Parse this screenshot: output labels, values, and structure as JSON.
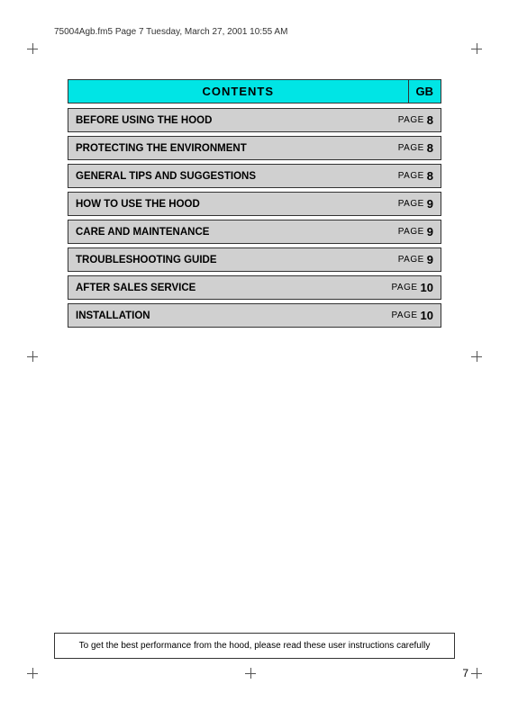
{
  "header": {
    "file_info": "75004Agb.fm5  Page 7  Tuesday, March 27, 2001  10:55 AM"
  },
  "contents": {
    "title": "CONTENTS",
    "gb_label": "GB",
    "rows": [
      {
        "label": "BEFORE USING THE HOOD",
        "page_word": "PAGE",
        "page_num": "8"
      },
      {
        "label": "PROTECTING THE ENVIRONMENT",
        "page_word": "PAGE",
        "page_num": "8"
      },
      {
        "label": "GENERAL TIPS AND SUGGESTIONS",
        "page_word": "PAGE",
        "page_num": "8"
      },
      {
        "label": "HOW TO USE THE HOOD",
        "page_word": "PAGE",
        "page_num": "9"
      },
      {
        "label": "CARE AND MAINTENANCE",
        "page_word": "PAGE",
        "page_num": "9"
      },
      {
        "label": "TROUBLESHOOTING GUIDE",
        "page_word": "PAGE",
        "page_num": "9"
      },
      {
        "label": "AFTER SALES SERVICE",
        "page_word": "PAGE",
        "page_num": "10"
      },
      {
        "label": "INSTALLATION",
        "page_word": "PAGE",
        "page_num": "10"
      }
    ]
  },
  "footer": {
    "note": "To get the best performance from the hood, please read these user instructions carefully"
  },
  "page_number": "7"
}
